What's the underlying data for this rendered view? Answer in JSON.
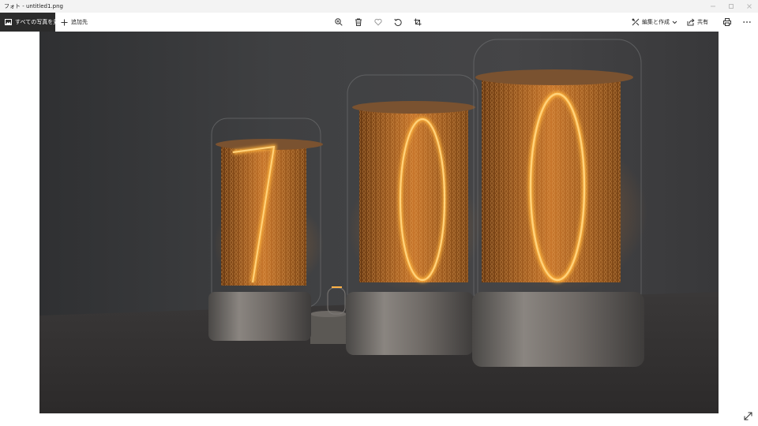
{
  "window": {
    "title": "フォト - untitled1.png",
    "controls": [
      "minimize-icon",
      "maximize-icon",
      "close-icon"
    ]
  },
  "toolbar": {
    "all_photos_label": "すべての写真を見る",
    "add_to_label": "追加先",
    "center_tools": [
      "zoom-in-icon",
      "delete-icon",
      "favorite-icon",
      "rotate-icon",
      "crop-icon"
    ],
    "edit_create_label": "編集と作成",
    "share_label": "共有",
    "print_icon": "printer-icon",
    "more_icon": "more-icon"
  },
  "photo": {
    "description_icon": "nixie-tube-image",
    "digits": [
      "7",
      "0",
      "0"
    ],
    "glow_color": "#ff9a1e",
    "background_color": "#3c3c3d"
  },
  "footer": {
    "expand_icon": "fullscreen-expand-icon"
  }
}
